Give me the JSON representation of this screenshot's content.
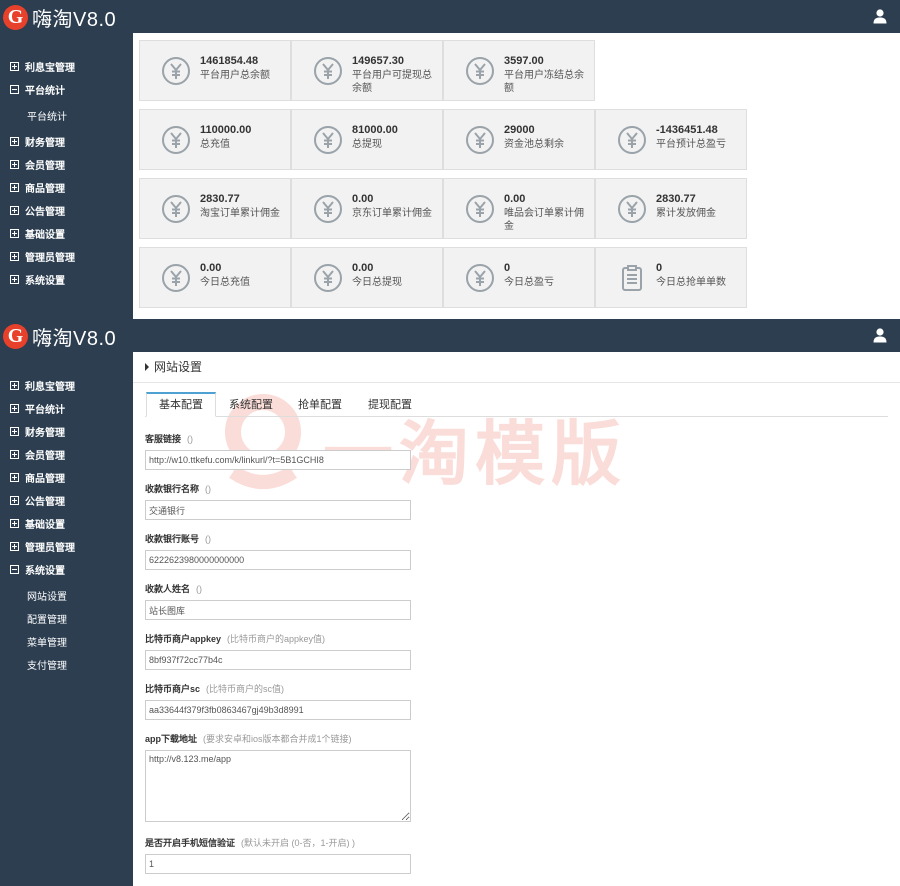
{
  "app": {
    "logo_letter": "G",
    "name": "嗨淘V8.0"
  },
  "dashboard": {
    "sidebar": {
      "items": [
        {
          "label": "利息宝管理",
          "expanded": false
        },
        {
          "label": "平台统计",
          "expanded": true
        },
        {
          "label": "财务管理",
          "expanded": false
        },
        {
          "label": "会员管理",
          "expanded": false
        },
        {
          "label": "商品管理",
          "expanded": false
        },
        {
          "label": "公告管理",
          "expanded": false
        },
        {
          "label": "基础设置",
          "expanded": false
        },
        {
          "label": "管理员管理",
          "expanded": false
        },
        {
          "label": "系统设置",
          "expanded": false
        }
      ],
      "subitems": [
        {
          "label": "平台统计"
        }
      ]
    },
    "cards": [
      {
        "value": "1461854.48",
        "label": "平台用户总余额",
        "icon": "yen-icon"
      },
      {
        "value": "149657.30",
        "label": "平台用户可提现总余额",
        "icon": "yen-icon"
      },
      {
        "value": "3597.00",
        "label": "平台用户冻结总余额",
        "icon": "yen-icon"
      },
      {
        "value": "110000.00",
        "label": "总充值",
        "icon": "yen-icon"
      },
      {
        "value": "81000.00",
        "label": "总提现",
        "icon": "yen-icon"
      },
      {
        "value": "29000",
        "label": "资金池总剩余",
        "icon": "yen-icon"
      },
      {
        "value": "-1436451.48",
        "label": "平台预计总盈亏",
        "icon": "yen-icon"
      },
      {
        "value": "2830.77",
        "label": "淘宝订单累计佣金",
        "icon": "yen-icon"
      },
      {
        "value": "0.00",
        "label": "京东订单累计佣金",
        "icon": "yen-icon"
      },
      {
        "value": "0.00",
        "label": "唯品会订单累计佣金",
        "icon": "yen-icon"
      },
      {
        "value": "2830.77",
        "label": "累计发放佣金",
        "icon": "yen-icon"
      },
      {
        "value": "0.00",
        "label": "今日总充值",
        "icon": "yen-icon"
      },
      {
        "value": "0.00",
        "label": "今日总提现",
        "icon": "yen-icon"
      },
      {
        "value": "0",
        "label": "今日总盈亏",
        "icon": "yen-icon"
      },
      {
        "value": "0",
        "label": "今日总抢单单数",
        "icon": "clipboard-icon"
      }
    ]
  },
  "settings": {
    "sidebar": {
      "items": [
        {
          "label": "利息宝管理",
          "expanded": false
        },
        {
          "label": "平台统计",
          "expanded": false
        },
        {
          "label": "财务管理",
          "expanded": false
        },
        {
          "label": "会员管理",
          "expanded": false
        },
        {
          "label": "商品管理",
          "expanded": false
        },
        {
          "label": "公告管理",
          "expanded": false
        },
        {
          "label": "基础设置",
          "expanded": false
        },
        {
          "label": "管理员管理",
          "expanded": false
        },
        {
          "label": "系统设置",
          "expanded": true
        }
      ],
      "subitems": [
        {
          "label": "网站设置"
        },
        {
          "label": "配置管理"
        },
        {
          "label": "菜单管理"
        },
        {
          "label": "支付管理"
        }
      ]
    },
    "panel_title": "网站设置",
    "tabs": [
      {
        "label": "基本配置",
        "active": true
      },
      {
        "label": "系统配置",
        "active": false
      },
      {
        "label": "抢单配置",
        "active": false
      },
      {
        "label": "提现配置",
        "active": false
      }
    ],
    "watermark": "一淘模版",
    "fields": [
      {
        "label": "客服链接",
        "hint": "()",
        "value": "http://w10.ttkefu.com/k/linkurl/?t=5B1GCHI8",
        "type": "input"
      },
      {
        "label": "收款银行名称",
        "hint": "()",
        "value": "交通银行",
        "type": "input"
      },
      {
        "label": "收款银行账号",
        "hint": "()",
        "value": "6222623980000000000",
        "type": "input"
      },
      {
        "label": "收款人姓名",
        "hint": "()",
        "value": "站长图库",
        "type": "input"
      },
      {
        "label": "比特币商户appkey",
        "hint": "(比特币商户的appkey值)",
        "value": "8bf937f72cc77b4c",
        "type": "input"
      },
      {
        "label": "比特币商户sc",
        "hint": "(比特币商户的sc值)",
        "value": "aa33644f379f3fb0863467gj49b3d8991",
        "type": "input"
      },
      {
        "label": "app下载地址",
        "hint": "(要求安卓和ios版本都合并成1个链接)",
        "value": "http://v8.123.me/app",
        "type": "textarea"
      },
      {
        "label": "是否开启手机短信验证",
        "hint": "(默认未开启 (0-否，1-开启) )",
        "value": "1",
        "type": "input"
      }
    ]
  },
  "colors": {
    "topbar": "#2c3e50",
    "sidebar": "#2c3e50",
    "logo": "#e8412b",
    "tab_accent": "#4ea1d3",
    "card_bg": "#f2f2f2"
  }
}
